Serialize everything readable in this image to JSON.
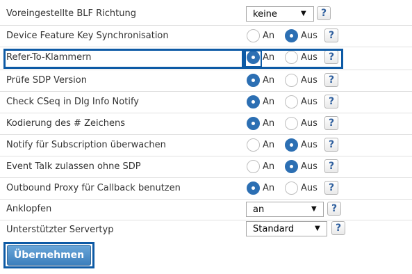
{
  "rows": [
    {
      "label": "Voreingestellte BLF Richtung",
      "type": "select",
      "value": "keine"
    },
    {
      "label": "Device Feature Key Synchronisation",
      "type": "radio",
      "on_label": "An",
      "off_label": "Aus",
      "selected": "Aus"
    },
    {
      "label": "Refer-To-Klammern",
      "type": "radio",
      "on_label": "An",
      "off_label": "Aus",
      "selected": "An"
    },
    {
      "label": "Prüfe SDP Version",
      "type": "radio",
      "on_label": "An",
      "off_label": "Aus",
      "selected": "An"
    },
    {
      "label": "Check CSeq in Dlg Info Notify",
      "type": "radio",
      "on_label": "An",
      "off_label": "Aus",
      "selected": "An"
    },
    {
      "label": "Kodierung des # Zeichens",
      "type": "radio",
      "on_label": "An",
      "off_label": "Aus",
      "selected": "An"
    },
    {
      "label": "Notify für Subscription überwachen",
      "type": "radio",
      "on_label": "An",
      "off_label": "Aus",
      "selected": "Aus"
    },
    {
      "label": "Event Talk zulassen ohne SDP",
      "type": "radio",
      "on_label": "An",
      "off_label": "Aus",
      "selected": "Aus"
    },
    {
      "label": "Outbound Proxy für Callback benutzen",
      "type": "radio",
      "on_label": "An",
      "off_label": "Aus",
      "selected": "An"
    },
    {
      "label": "Anklopfen",
      "type": "select",
      "value": "an"
    },
    {
      "label": "Unterstützter Servertyp",
      "type": "select",
      "value": "Standard"
    }
  ],
  "help_glyph": "?",
  "select_arrow": "▼",
  "submit_label": "Übernehmen",
  "colors": {
    "accent": "#2c6fb3",
    "highlight_border": "#0d5aa5",
    "button_top": "#6aa6d9",
    "button_bottom": "#3c7fbd"
  }
}
